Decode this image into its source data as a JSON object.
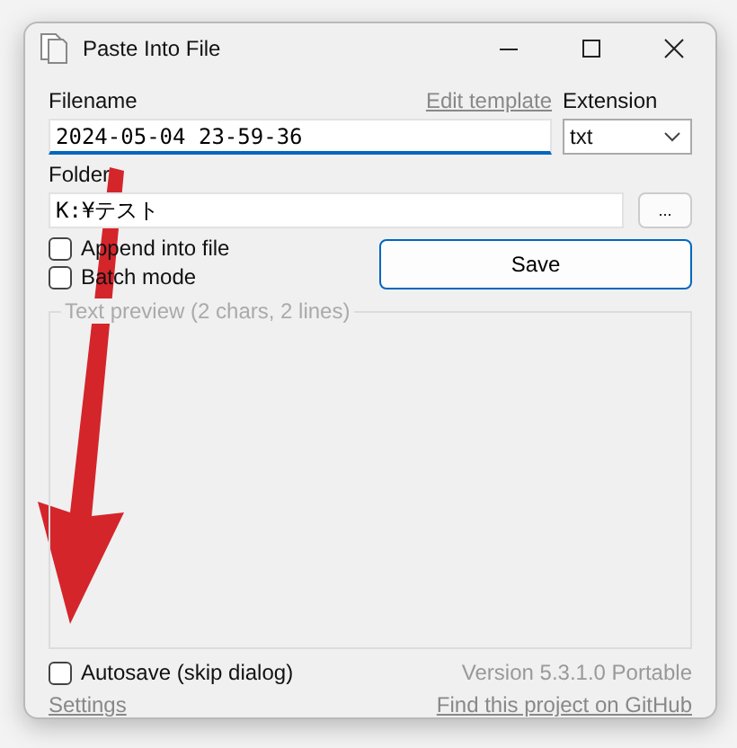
{
  "window": {
    "title": "Paste Into File"
  },
  "filename": {
    "label": "Filename",
    "value": "2024-05-04 23-59-36",
    "focused": true
  },
  "edit_template": "Edit template",
  "extension": {
    "label": "Extension",
    "value": "txt"
  },
  "folder": {
    "label": "Folder",
    "value": "K:¥テスト",
    "browse": "..."
  },
  "options": [
    {
      "label": "Append into file",
      "checked": false
    },
    {
      "label": "Batch mode",
      "checked": false
    }
  ],
  "save_button": "Save",
  "preview": {
    "title": "Text preview (2 chars, 2 lines)"
  },
  "autosave": {
    "label": "Autosave (skip dialog)",
    "checked": false
  },
  "settings_link": "Settings",
  "version": "Version 5.3.1.0 Portable",
  "github_link": "Find this project on GitHub",
  "annotation": {
    "kind": "arrow"
  }
}
